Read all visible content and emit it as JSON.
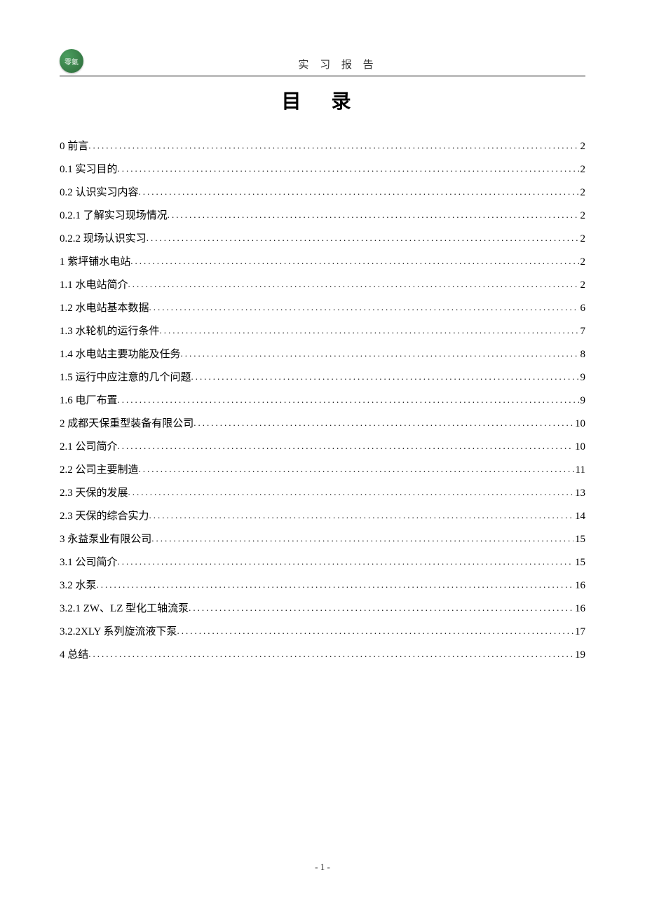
{
  "header": {
    "logo_text": "零氪",
    "title": "实 习 报 告"
  },
  "doc_title": "目  录",
  "toc": [
    {
      "label": "0 前言",
      "page": "2"
    },
    {
      "label": "0.1 实习目的",
      "page": "2"
    },
    {
      "label": "0.2 认识实习内容",
      "page": "2"
    },
    {
      "label": "0.2.1 了解实习现场情况",
      "page": "2"
    },
    {
      "label": "0.2.2 现场认识实习",
      "page": "2"
    },
    {
      "label": "1 紫坪铺水电站",
      "page": "2"
    },
    {
      "label": "1.1 水电站简介",
      "page": "2"
    },
    {
      "label": "1.2 水电站基本数据",
      "page": "6"
    },
    {
      "label": "1.3 水轮机的运行条件",
      "page": "7"
    },
    {
      "label": "1.4 水电站主要功能及任务",
      "page": "8"
    },
    {
      "label": "1.5 运行中应注意的几个问题",
      "page": "9"
    },
    {
      "label": "1.6 电厂布置",
      "page": "9"
    },
    {
      "label": "2 成都天保重型装备有限公司",
      "page": "10"
    },
    {
      "label": "2.1 公司简介",
      "page": "10"
    },
    {
      "label": "2.2 公司主要制造",
      "page": "11"
    },
    {
      "label": "2.3 天保的发展",
      "page": "13"
    },
    {
      "label": "2.3 天保的综合实力",
      "page": "14"
    },
    {
      "label": "3 永益泵业有限公司",
      "page": "15"
    },
    {
      "label": "3.1 公司简介",
      "page": "15"
    },
    {
      "label": "3.2 水泵",
      "page": "16"
    },
    {
      "label": "3.2.1  ZW、LZ 型化工轴流泵",
      "page": "16"
    },
    {
      "label": "3.2.2XLY 系列旋流液下泵",
      "page": "17"
    },
    {
      "label": "4 总结",
      "page": "19"
    }
  ],
  "footer": {
    "page_number": "- 1 -"
  }
}
